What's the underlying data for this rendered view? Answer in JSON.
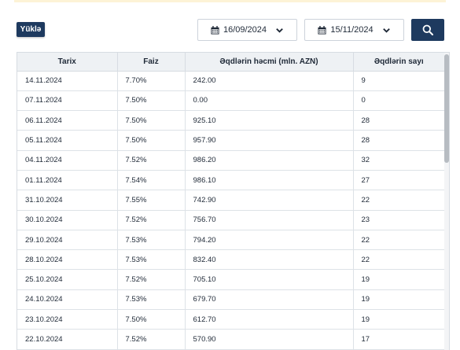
{
  "toolbar": {
    "load_label": "Yüklə",
    "date_from": "16/09/2024",
    "date_to": "15/11/2024",
    "calendar_icon": "calendar-icon",
    "chevron_icon": "chevron-down-icon",
    "search_icon": "search-icon"
  },
  "colors": {
    "primary": "#1e3a5f",
    "header_bg": "#eef1f4",
    "accent_bar": "#fdf3d6"
  },
  "table": {
    "headers": [
      "Tarix",
      "Faiz",
      "Əqdlərin həcmi (mln. AZN)",
      "Əqdlərin sayı"
    ],
    "rows": [
      [
        "14.11.2024",
        "7.70%",
        "242.00",
        "9"
      ],
      [
        "07.11.2024",
        "7.50%",
        "0.00",
        "0"
      ],
      [
        "06.11.2024",
        "7.50%",
        "925.10",
        "28"
      ],
      [
        "05.11.2024",
        "7.50%",
        "957.90",
        "28"
      ],
      [
        "04.11.2024",
        "7.52%",
        "986.20",
        "32"
      ],
      [
        "01.11.2024",
        "7.54%",
        "986.10",
        "27"
      ],
      [
        "31.10.2024",
        "7.55%",
        "742.90",
        "22"
      ],
      [
        "30.10.2024",
        "7.52%",
        "756.70",
        "23"
      ],
      [
        "29.10.2024",
        "7.53%",
        "794.20",
        "22"
      ],
      [
        "28.10.2024",
        "7.53%",
        "832.40",
        "22"
      ],
      [
        "25.10.2024",
        "7.52%",
        "705.10",
        "19"
      ],
      [
        "24.10.2024",
        "7.53%",
        "679.70",
        "19"
      ],
      [
        "23.10.2024",
        "7.50%",
        "612.70",
        "19"
      ],
      [
        "22.10.2024",
        "7.52%",
        "570.90",
        "17"
      ]
    ]
  }
}
